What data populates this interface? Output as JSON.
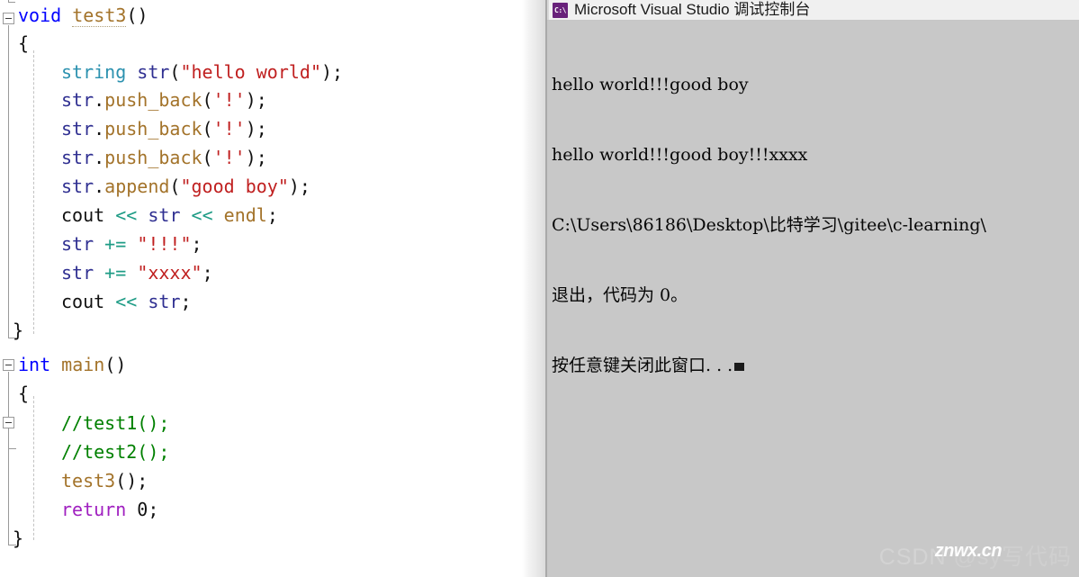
{
  "editor": {
    "language": "cpp",
    "colors": {
      "keyword": "#0000ff",
      "type": "#2b91af",
      "function": "#a3732a",
      "variable": "#2f2f91",
      "string": "#c02020",
      "comment": "#008000",
      "operator": "#1f9c86",
      "control": "#a020c0",
      "plain": "#111111",
      "background": "#ffffff"
    },
    "lines": [
      {
        "tokens": [
          {
            "t": "void",
            "c": "kw"
          },
          {
            "t": " ",
            "c": "plain"
          },
          {
            "t": "test3",
            "c": "fn-u"
          },
          {
            "t": "()",
            "c": "punc"
          }
        ]
      },
      {
        "tokens": [
          {
            "t": "{",
            "c": "punc"
          }
        ]
      },
      {
        "tokens": [
          {
            "t": "string",
            "c": "type"
          },
          {
            "t": " ",
            "c": "plain"
          },
          {
            "t": "str",
            "c": "var"
          },
          {
            "t": "(",
            "c": "punc"
          },
          {
            "t": "\"hello world\"",
            "c": "str"
          },
          {
            "t": ");",
            "c": "punc"
          }
        ]
      },
      {
        "tokens": [
          {
            "t": "str",
            "c": "var"
          },
          {
            "t": ".",
            "c": "punc"
          },
          {
            "t": "push_back",
            "c": "fn"
          },
          {
            "t": "(",
            "c": "punc"
          },
          {
            "t": "'!'",
            "c": "str"
          },
          {
            "t": ");",
            "c": "punc"
          }
        ]
      },
      {
        "tokens": [
          {
            "t": "str",
            "c": "var"
          },
          {
            "t": ".",
            "c": "punc"
          },
          {
            "t": "push_back",
            "c": "fn"
          },
          {
            "t": "(",
            "c": "punc"
          },
          {
            "t": "'!'",
            "c": "str"
          },
          {
            "t": ");",
            "c": "punc"
          }
        ]
      },
      {
        "tokens": [
          {
            "t": "str",
            "c": "var"
          },
          {
            "t": ".",
            "c": "punc"
          },
          {
            "t": "push_back",
            "c": "fn"
          },
          {
            "t": "(",
            "c": "punc"
          },
          {
            "t": "'!'",
            "c": "str"
          },
          {
            "t": ");",
            "c": "punc"
          }
        ]
      },
      {
        "tokens": [
          {
            "t": "str",
            "c": "var"
          },
          {
            "t": ".",
            "c": "punc"
          },
          {
            "t": "append",
            "c": "fn"
          },
          {
            "t": "(",
            "c": "punc"
          },
          {
            "t": "\"good boy\"",
            "c": "str"
          },
          {
            "t": ");",
            "c": "punc"
          }
        ]
      },
      {
        "tokens": [
          {
            "t": "cout",
            "c": "plain"
          },
          {
            "t": " ",
            "c": "plain"
          },
          {
            "t": "<<",
            "c": "op"
          },
          {
            "t": " ",
            "c": "plain"
          },
          {
            "t": "str",
            "c": "var"
          },
          {
            "t": " ",
            "c": "plain"
          },
          {
            "t": "<<",
            "c": "op"
          },
          {
            "t": " ",
            "c": "plain"
          },
          {
            "t": "endl",
            "c": "fn"
          },
          {
            "t": ";",
            "c": "punc"
          }
        ]
      },
      {
        "tokens": [
          {
            "t": "str",
            "c": "var"
          },
          {
            "t": " ",
            "c": "plain"
          },
          {
            "t": "+=",
            "c": "op"
          },
          {
            "t": " ",
            "c": "plain"
          },
          {
            "t": "\"!!!\"",
            "c": "str"
          },
          {
            "t": ";",
            "c": "punc"
          }
        ]
      },
      {
        "tokens": [
          {
            "t": "str",
            "c": "var"
          },
          {
            "t": " ",
            "c": "plain"
          },
          {
            "t": "+=",
            "c": "op"
          },
          {
            "t": " ",
            "c": "plain"
          },
          {
            "t": "\"xxxx\"",
            "c": "str"
          },
          {
            "t": ";",
            "c": "punc"
          }
        ]
      },
      {
        "tokens": [
          {
            "t": "cout",
            "c": "plain"
          },
          {
            "t": " ",
            "c": "plain"
          },
          {
            "t": "<<",
            "c": "op"
          },
          {
            "t": " ",
            "c": "plain"
          },
          {
            "t": "str",
            "c": "var"
          },
          {
            "t": ";",
            "c": "punc"
          }
        ]
      },
      {
        "tokens": [
          {
            "t": "}",
            "c": "punc"
          }
        ]
      },
      {
        "tokens": [
          {
            "t": "int",
            "c": "kw"
          },
          {
            "t": " ",
            "c": "plain"
          },
          {
            "t": "main",
            "c": "fn"
          },
          {
            "t": "()",
            "c": "punc"
          }
        ]
      },
      {
        "tokens": [
          {
            "t": "{",
            "c": "punc"
          }
        ]
      },
      {
        "tokens": [
          {
            "t": "//test1();",
            "c": "cmt"
          }
        ]
      },
      {
        "tokens": [
          {
            "t": "//test2();",
            "c": "cmt"
          }
        ]
      },
      {
        "tokens": [
          {
            "t": "test3",
            "c": "fn"
          },
          {
            "t": "();",
            "c": "punc"
          }
        ]
      },
      {
        "tokens": [
          {
            "t": "return",
            "c": "ctl"
          },
          {
            "t": " ",
            "c": "plain"
          },
          {
            "t": "0",
            "c": "num"
          },
          {
            "t": ";",
            "c": "punc"
          }
        ]
      },
      {
        "tokens": [
          {
            "t": "}",
            "c": "punc"
          }
        ]
      }
    ]
  },
  "console": {
    "title": "Microsoft Visual Studio 调试控制台",
    "icon": "console-window-icon",
    "icon_label": "C:\\",
    "background": "#c8c8c8",
    "output": [
      "hello world!!!good boy",
      "hello world!!!good boy!!!xxxx",
      "C:\\Users\\86186\\Desktop\\比特学习\\gitee\\c-learning\\",
      "退出，代码为 0。",
      "按任意键关闭此窗口. . ."
    ]
  },
  "watermark": {
    "site": "CSDN",
    "author": "@sy写代码",
    "overlay": "znwx.cn"
  }
}
